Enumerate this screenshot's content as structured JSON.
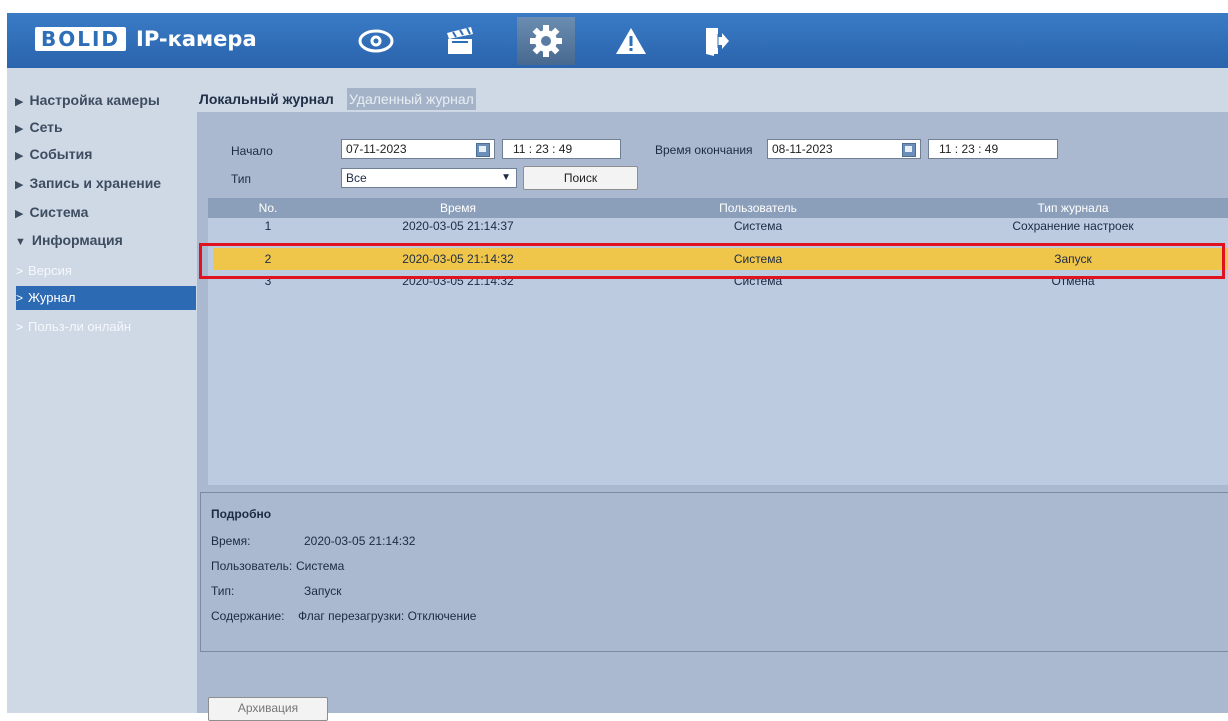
{
  "app": {
    "logo": "BOLID",
    "title": "IP-камера"
  },
  "nav": [
    {
      "icon": "eye-icon",
      "label": "Просмотр"
    },
    {
      "icon": "clapperboard-icon",
      "label": "Запись"
    },
    {
      "icon": "gear-icon",
      "label": "Настройка"
    },
    {
      "icon": "warning-icon",
      "label": "Тревога"
    },
    {
      "icon": "logout-icon",
      "label": "Выход"
    }
  ],
  "sidebar": {
    "items": [
      {
        "label": "Настройка камеры"
      },
      {
        "label": "Сеть"
      },
      {
        "label": "События"
      },
      {
        "label": "Запись и хранение"
      },
      {
        "label": "Система"
      },
      {
        "label": "Информация"
      }
    ],
    "sub_items": [
      {
        "label": "Версия"
      },
      {
        "label": "Журнал"
      },
      {
        "label": "Польз-ли онлайн"
      }
    ]
  },
  "tabs": [
    {
      "label": "Локальный журнал"
    },
    {
      "label": "Удаленный журнал"
    }
  ],
  "filter": {
    "start_label": "Начало",
    "start_date": "07-11-2023",
    "start_time": "11  :  23  :  49",
    "end_label": "Время окончания",
    "end_date": "08-11-2023",
    "end_time": "11  :  23  :  49",
    "type_label": "Тип",
    "type_value": "Все",
    "search_button": "Поиск"
  },
  "table": {
    "columns": [
      "No.",
      "Время",
      "Пользователь",
      "Тип журнала"
    ],
    "rows": [
      [
        "1",
        "2020-03-05 21:14:37",
        "Система",
        "Сохранение настроек"
      ],
      [
        "2",
        "2020-03-05 21:14:32",
        "Система",
        "Запуск"
      ],
      [
        "3",
        "2020-03-05 21:14:32",
        "Система",
        "Отмена"
      ]
    ]
  },
  "details": {
    "title": "Подробно",
    "time_label": "Время:",
    "time_value": "2020-03-05 21:14:32",
    "user_label": "Пользователь:",
    "user_value": "Система",
    "type_label": "Тип:",
    "type_value": "Запуск",
    "content_label": "Содержание:",
    "content_value": "Флаг перезагрузки: Отключение"
  },
  "bottom": {
    "archive_button": "Архивация"
  },
  "colors": {
    "topbar": "#2d6eb8",
    "selected_row": "#efc64a",
    "highlight": "#e1121f",
    "panel": "#aab9cf"
  }
}
